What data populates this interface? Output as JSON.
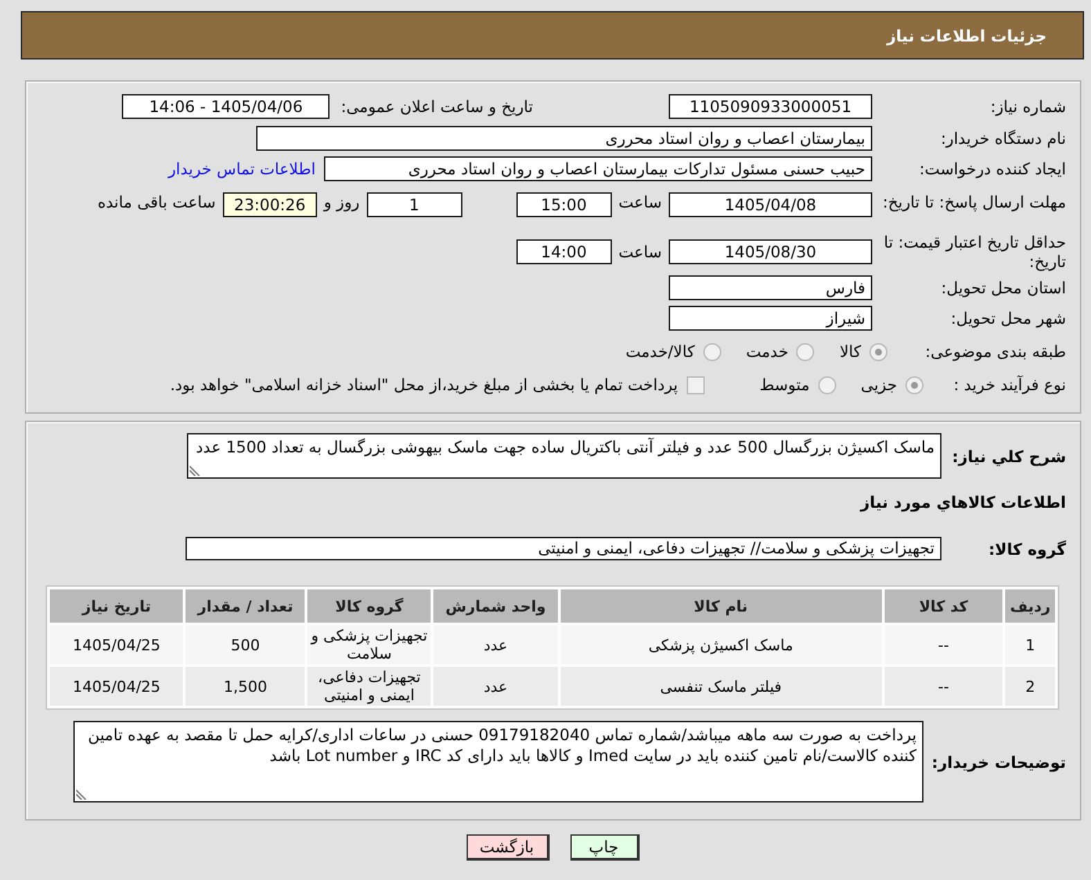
{
  "header": {
    "title": "جزئیات اطلاعات نیاز"
  },
  "need_info": {
    "need_number": {
      "label": "شماره نیاز:",
      "value": "1105090933000051"
    },
    "announce_datetime": {
      "label": "تاریخ و ساعت اعلان عمومی:",
      "value": "1405/04/06 - 14:06"
    },
    "buyer_org": {
      "label": "نام دستگاه خریدار:",
      "value": "بیمارستان اعصاب و روان استاد محرری"
    },
    "requester": {
      "label": "ایجاد کننده درخواست:",
      "value": "حبیب حسنی مسئول تدارکات بیمارستان اعصاب و روان استاد محرری",
      "contact_link": "اطلاعات تماس خریدار"
    },
    "response_deadline": {
      "label": "مهلت ارسال پاسخ: تا تاریخ:",
      "date": "1405/04/08",
      "time_label": "ساعت",
      "time": "15:00",
      "days": "1",
      "days_label": "روز و",
      "remaining": "23:00:26",
      "remaining_label": "ساعت باقی مانده"
    },
    "price_validity": {
      "label": "حداقل تاریخ اعتبار قیمت: تا تاریخ:",
      "date": "1405/08/30",
      "time_label": "ساعت",
      "time": "14:00"
    },
    "delivery_province": {
      "label": "استان محل تحویل:",
      "value": "فارس"
    },
    "delivery_city": {
      "label": "شهر محل تحویل:",
      "value": "شیراز"
    },
    "subject_category": {
      "label": "طبقه بندی موضوعی:",
      "options": [
        {
          "label": "کالا",
          "selected": true,
          "disabled": true
        },
        {
          "label": "خدمت",
          "selected": false,
          "disabled": true
        },
        {
          "label": "کالا/خدمت",
          "selected": false,
          "disabled": true
        }
      ]
    },
    "purchase_process": {
      "label": "نوع فرآیند خرید :",
      "options": [
        {
          "label": "جزیی",
          "selected": true,
          "disabled": true
        },
        {
          "label": "متوسط",
          "selected": false,
          "disabled": true
        }
      ],
      "treasury_payment": {
        "label": "پرداخت تمام یا بخشی از مبلغ خرید،از محل \"اسناد خزانه اسلامی\" خواهد بود.",
        "checked": false,
        "disabled": true
      }
    }
  },
  "details": {
    "description": {
      "label": "شرح کلي نياز:",
      "value": "ماسک اکسیژن بزرگسال 500 عدد و فیلتر آنتی باکتریال ساده جهت ماسک بیهوشی بزرگسال به تعداد 1500 عدد"
    },
    "goods_title": "اطلاعات کالاهاي مورد نياز",
    "goods_group": {
      "label": "گروه کالا:",
      "value": "تجهیزات پزشکی و سلامت// تجهیزات دفاعی، ایمنی و امنیتی"
    },
    "table": {
      "columns": [
        "ردیف",
        "کد کالا",
        "نام کالا",
        "واحد شمارش",
        "گروه کالا",
        "تعداد / مقدار",
        "تاریخ نیاز"
      ],
      "rows": [
        [
          "1",
          "--",
          "ماسک اکسیژن پزشکی",
          "عدد",
          "تجهیزات پزشکی و سلامت",
          "500",
          "1405/04/25"
        ],
        [
          "2",
          "--",
          "فیلتر ماسک تنفسی",
          "عدد",
          "تجهیزات دفاعی، ایمنی و امنیتی",
          "1,500",
          "1405/04/25"
        ]
      ]
    },
    "buyer_notes": {
      "label": "توضیحات خریدار:",
      "value": "پرداخت به صورت سه ماهه میباشد/شماره تماس 09179182040 حسنی در ساعات اداری/کرایه حمل تا مقصد به عهده تامین کننده کالاست/نام تامین کننده باید در سایت Imed و کالاها باید دارای کد IRC و Lot number باشد"
    }
  },
  "buttons": [
    {
      "label": "چاپ",
      "kind": "print"
    },
    {
      "label": "بازگشت",
      "kind": "back"
    }
  ]
}
